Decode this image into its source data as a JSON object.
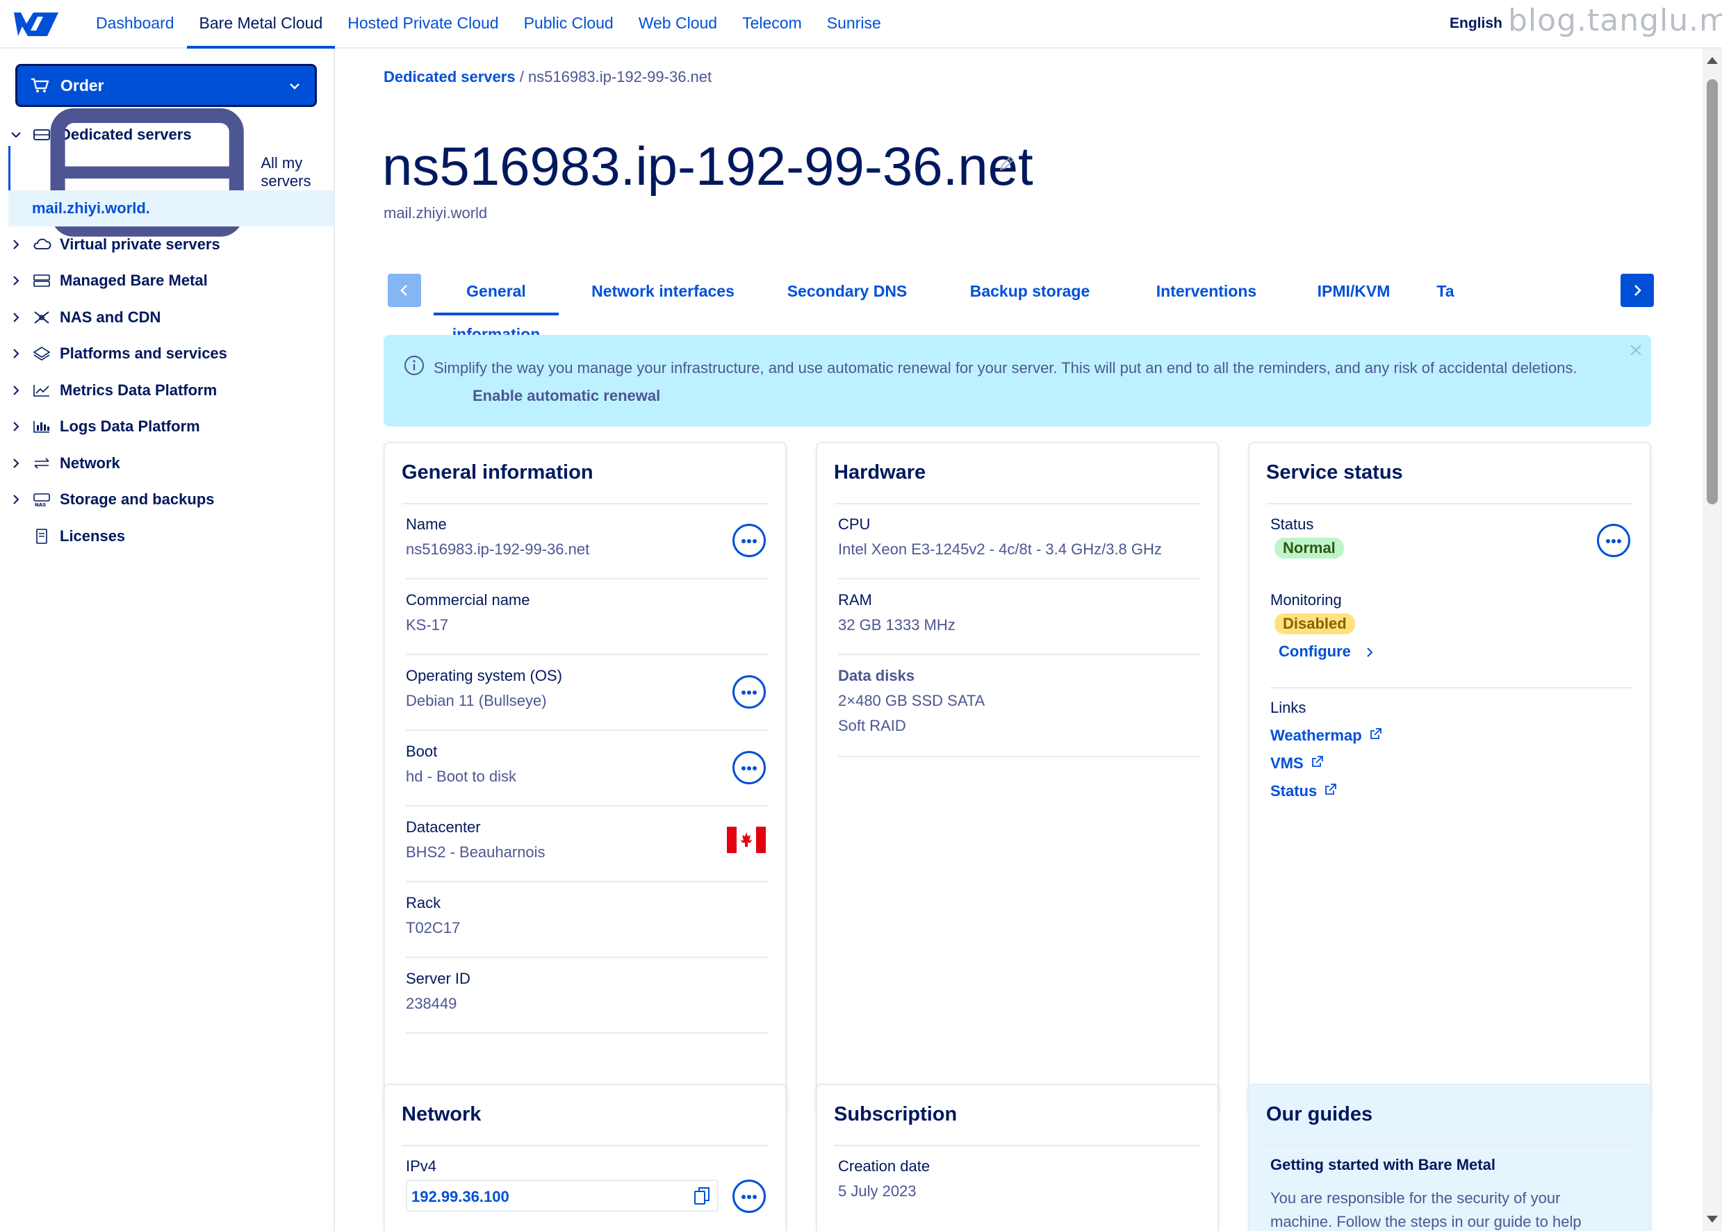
{
  "topnav": {
    "links": [
      "Dashboard",
      "Bare Metal Cloud",
      "Hosted Private Cloud",
      "Public Cloud",
      "Web Cloud",
      "Telecom",
      "Sunrise"
    ],
    "active_index": 1,
    "language": "English",
    "watermark": "blog.tanglu.me"
  },
  "sidebar": {
    "order_label": "Order",
    "items": [
      {
        "label": "Dedicated servers",
        "icon": "server-icon",
        "expanded": true
      },
      {
        "label": "Virtual private servers",
        "icon": "cloud-icon"
      },
      {
        "label": "Managed Bare Metal",
        "icon": "managed-server-icon"
      },
      {
        "label": "NAS and CDN",
        "icon": "nas-icon"
      },
      {
        "label": "Platforms and services",
        "icon": "platforms-icon"
      },
      {
        "label": "Metrics Data Platform",
        "icon": "metrics-icon"
      },
      {
        "label": "Logs Data Platform",
        "icon": "logs-icon"
      },
      {
        "label": "Network",
        "icon": "network-icon"
      },
      {
        "label": "Storage and backups",
        "icon": "storage-icon"
      },
      {
        "label": "Licenses",
        "icon": "license-icon"
      }
    ],
    "subitems": [
      {
        "label": "All my servers"
      },
      {
        "label": "mail.zhiyi.world."
      }
    ]
  },
  "breadcrumb": {
    "parent": "Dedicated servers",
    "separator": "/",
    "current": "ns516983.ip-192-99-36.net"
  },
  "page": {
    "title": "ns516983.ip-192-99-36.net",
    "subtitle": "mail.zhiyi.world"
  },
  "tabs": [
    "General information",
    "Network interfaces",
    "Secondary DNS",
    "Backup storage",
    "Interventions",
    "IPMI/KVM",
    "Ta"
  ],
  "banner": {
    "message": "Simplify the way you manage your infrastructure, and use automatic renewal for your server. This will put an end to all the reminders, and any risk of accidental deletions.",
    "link": "Enable automatic renewal"
  },
  "general_info": {
    "title": "General information",
    "fields": [
      {
        "label": "Name",
        "value": "ns516983.ip-192-99-36.net"
      },
      {
        "label": "Commercial name",
        "value": "KS-17"
      },
      {
        "label": "Operating system (OS)",
        "value": "Debian 11 (Bullseye)"
      },
      {
        "label": "Boot",
        "value": "hd - Boot to disk"
      },
      {
        "label": "Datacenter",
        "value": "BHS2 - Beauharnois"
      },
      {
        "label": "Rack",
        "value": "T02C17"
      },
      {
        "label": "Server ID",
        "value": "238449"
      }
    ]
  },
  "hardware": {
    "title": "Hardware",
    "fields": [
      {
        "label": "CPU",
        "value": "Intel Xeon E3-1245v2 - 4c/8t - 3.4 GHz/3.8 GHz"
      },
      {
        "label": "RAM",
        "value": "32 GB 1333 MHz"
      },
      {
        "label": "Data disks",
        "value": "2×480 GB SSD SATA",
        "value2": "Soft RAID"
      }
    ]
  },
  "service_status": {
    "title": "Service status",
    "status_label": "Status",
    "status_value": "Normal",
    "monitoring_label": "Monitoring",
    "monitoring_value": "Disabled",
    "configure_label": "Configure",
    "links_label": "Links",
    "links": [
      "Weathermap",
      "VMS",
      "Status"
    ]
  },
  "network": {
    "title": "Network",
    "ipv4_label": "IPv4",
    "ipv4_value": "192.99.36.100"
  },
  "subscription": {
    "title": "Subscription",
    "creation_label": "Creation date",
    "creation_value": "5 July 2023"
  },
  "guides": {
    "title": "Our guides",
    "item_title": "Getting started with Bare Metal",
    "item_text": "You are responsible for the security of your machine. Follow the steps in our guide to help"
  },
  "colors": {
    "brand": "#0050d7",
    "navy": "#00185e",
    "banner_bg": "#bef1ff",
    "normal_badge": "#bcf5c9",
    "disabled_badge": "#ffe27d"
  }
}
